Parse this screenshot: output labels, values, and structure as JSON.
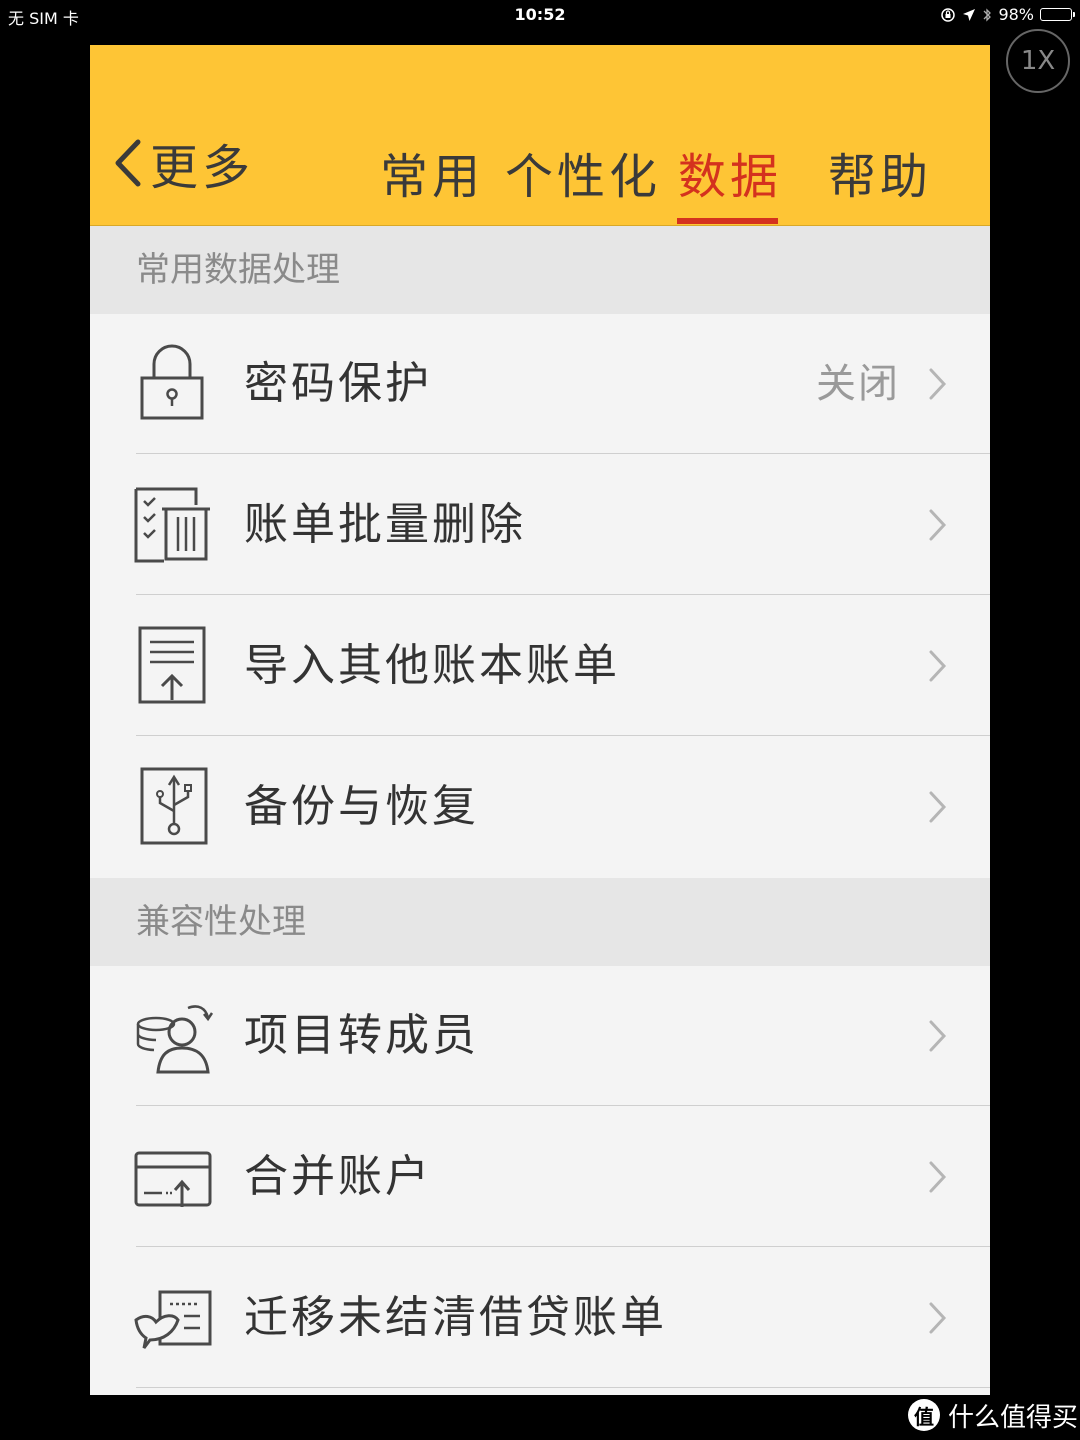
{
  "status_bar": {
    "carrier": "无 SIM 卡",
    "time": "10:52",
    "battery": "98%",
    "battery_level": 0.98
  },
  "zoom_button": {
    "label": "1X"
  },
  "nav": {
    "back_label": "更多",
    "tabs": [
      {
        "label": "常用"
      },
      {
        "label": "个性化"
      },
      {
        "label": "数据"
      },
      {
        "label": "帮助"
      }
    ],
    "active_tab": "数据"
  },
  "sections": [
    {
      "header": "常用数据处理",
      "items": [
        {
          "label": "密码保护",
          "value": "关闭",
          "icon": "lock-icon"
        },
        {
          "label": "账单批量删除",
          "icon": "checklist-trash-icon"
        },
        {
          "label": "导入其他账本账单",
          "icon": "import-document-icon"
        },
        {
          "label": "备份与恢复",
          "icon": "usb-backup-icon"
        }
      ]
    },
    {
      "header": "兼容性处理",
      "items": [
        {
          "label": "项目转成员",
          "icon": "coins-to-person-icon"
        },
        {
          "label": "合并账户",
          "icon": "merge-card-icon"
        },
        {
          "label": "迁移未结清借贷账单",
          "icon": "bird-document-icon"
        }
      ]
    }
  ],
  "watermark": {
    "badge": "值",
    "text": "什么值得买"
  },
  "colors": {
    "nav_bg": "#fec535",
    "accent": "#d4321e",
    "section_bg": "#e6e6e6",
    "row_bg": "#f4f4f4"
  }
}
